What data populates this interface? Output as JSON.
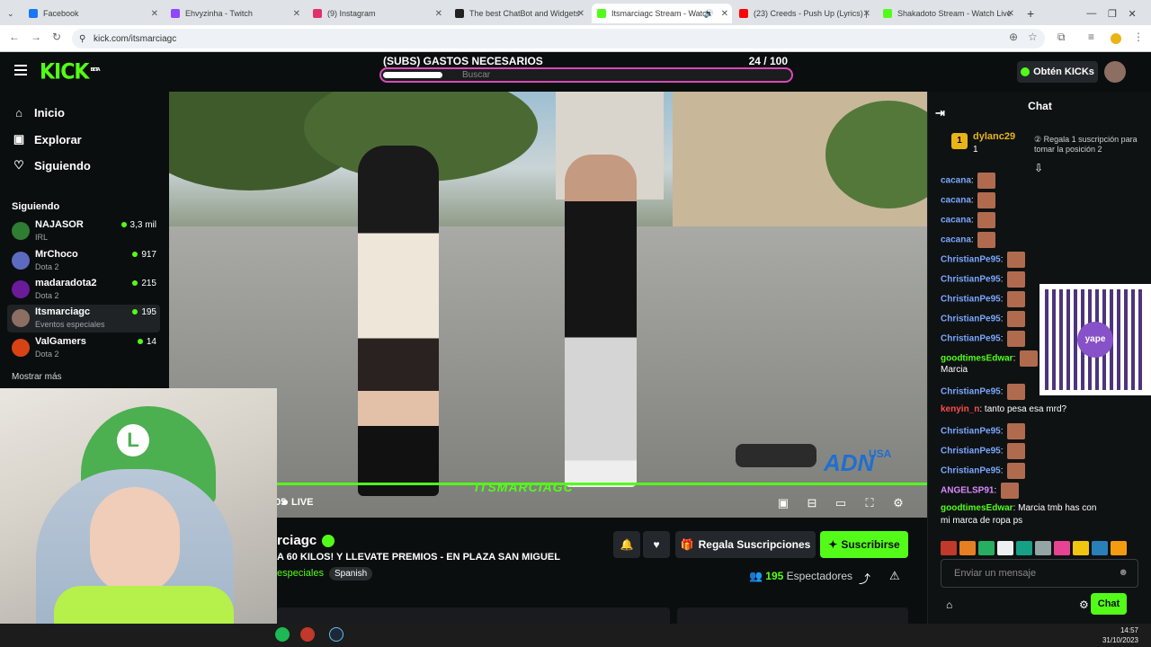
{
  "browser": {
    "tabs": [
      {
        "title": "Facebook",
        "color": "#1877f2",
        "active": false
      },
      {
        "title": "Ehvyzinha - Twitch",
        "color": "#9146ff",
        "active": false
      },
      {
        "title": "(9) Instagram",
        "color": "#e1306c",
        "active": false
      },
      {
        "title": "The best ChatBot and Widgets",
        "color": "#222222",
        "active": false
      },
      {
        "title": "Itsmarciagc Stream - Watch",
        "color": "#53fc18",
        "active": true
      },
      {
        "title": "(23) Creeds - Push Up (Lyrics) |",
        "color": "#ff0000",
        "active": false
      },
      {
        "title": "Shakadoto Stream - Watch Live",
        "color": "#53fc18",
        "active": false
      }
    ],
    "url": "kick.com/itsmarciagc"
  },
  "site": {
    "logo": "KICK",
    "logo_tag": "BETA",
    "goal_label": "(SUBS) GASTOS NECESARIOS",
    "goal_current": "24",
    "goal_total": "/ 100",
    "goal_progress": 0.24,
    "search_placeholder": "Buscar",
    "get_kicks": "Obtén KICKs"
  },
  "sidebar": {
    "nav": [
      {
        "label": "Inicio",
        "icon": "home-icon",
        "glyph": "⌂"
      },
      {
        "label": "Explorar",
        "icon": "compass-icon",
        "glyph": "▣"
      },
      {
        "label": "Siguiendo",
        "icon": "heart-icon",
        "glyph": "♡"
      }
    ],
    "section_label": "Siguiendo",
    "channels": [
      {
        "name": "NAJASOR",
        "category": "IRL",
        "viewers": "3,3 mil",
        "avatar": "#2e7d32"
      },
      {
        "name": "MrChoco",
        "category": "Dota 2",
        "viewers": "917",
        "avatar": "#5c6bc0"
      },
      {
        "name": "madaradota2",
        "category": "Dota 2",
        "viewers": "215",
        "avatar": "#6a1b9a"
      },
      {
        "name": "Itsmarciagc",
        "category": "Eventos especiales",
        "viewers": "195",
        "avatar": "#8d6e63"
      },
      {
        "name": "ValGamers",
        "category": "Dota 2",
        "viewers": "14",
        "avatar": "#d84315"
      }
    ],
    "show_more": "Mostrar más"
  },
  "video": {
    "watermark": "ITSMARCIAGC",
    "live_label": "LIVE",
    "live_time": "05",
    "overlay_logo": "ADN",
    "overlay_country": "USA"
  },
  "stream": {
    "title_partial": "rciagc",
    "description": "A 60 KILOS! Y LLEVATE PREMIOS - EN PLAZA SAN MIGUEL",
    "category": "especiales",
    "language": "Spanish",
    "gift_label": "Regala Suscripciones",
    "subscribe_label": "Suscribirse",
    "viewers_count": "195",
    "viewers_label": "Espectadores"
  },
  "chat": {
    "title": "Chat",
    "pinned_user": "dylanc29",
    "pinned_rank": "1",
    "pinned_count": "1",
    "pinned_message": "Regala 1 suscripción para tomar la posición 2",
    "messages": [
      {
        "user": "cacana",
        "text": "",
        "color": "#7aa7ff"
      },
      {
        "user": "cacana",
        "text": "",
        "color": "#7aa7ff"
      },
      {
        "user": "cacana",
        "text": "",
        "color": "#7aa7ff"
      },
      {
        "user": "cacana",
        "text": "",
        "color": "#7aa7ff"
      },
      {
        "user": "ChristianPe95",
        "text": "",
        "color": "#7aa7ff"
      },
      {
        "user": "ChristianPe95",
        "text": "",
        "color": "#7aa7ff"
      },
      {
        "user": "ChristianPe95",
        "text": "",
        "color": "#7aa7ff"
      },
      {
        "user": "ChristianPe95",
        "text": "",
        "color": "#7aa7ff"
      },
      {
        "user": "ChristianPe95",
        "text": "",
        "color": "#7aa7ff"
      },
      {
        "user": "goodtimesEdwar",
        "text": "",
        "color": "#53fc18"
      },
      {
        "user": "",
        "text": "Marcia",
        "color": "#ffffff"
      },
      {
        "user": "ChristianPe95",
        "text": "",
        "color": "#7aa7ff"
      },
      {
        "user": "kenyin_n",
        "text": "tanto pesa esa mrd?",
        "color": "#ff4d4d"
      },
      {
        "user": "ChristianPe95",
        "text": "",
        "color": "#7aa7ff"
      },
      {
        "user": "ChristianPe95",
        "text": "",
        "color": "#7aa7ff"
      },
      {
        "user": "ChristianPe95",
        "text": "",
        "color": "#7aa7ff"
      },
      {
        "user": "ANGELSP91",
        "text": "",
        "color": "#d88cff"
      },
      {
        "user": "goodtimesEdwar",
        "text": "Marcia tmb has con",
        "color": "#53fc18"
      },
      {
        "user": "",
        "text": "mi marca de ropa ps",
        "color": "#ffffff"
      }
    ],
    "qr_label": "yape",
    "input_placeholder": "Enviar un mensaje",
    "send_label": "Chat"
  },
  "taskbar": {
    "time": "14:57",
    "date": "31/10/2023"
  },
  "colors": {
    "accent": "#53fc18",
    "goal_border": "#d84ab8"
  }
}
